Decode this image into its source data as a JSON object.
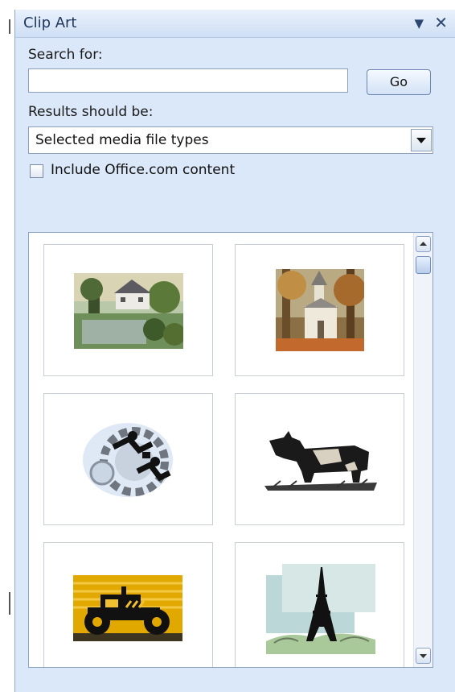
{
  "pane": {
    "title": "Clip Art",
    "dropdown_icon": "triangle-down",
    "close_icon": "x"
  },
  "search": {
    "label": "Search for:",
    "value": "",
    "go_label": "Go"
  },
  "results_filter": {
    "label": "Results should be:",
    "selected": "Selected media file types"
  },
  "include_office": {
    "label": "Include Office.com content",
    "checked": false
  },
  "results": {
    "items": [
      {
        "icon": "cottage-lake-clipart"
      },
      {
        "icon": "church-autumn-clipart"
      },
      {
        "icon": "business-gear-clipart"
      },
      {
        "icon": "cow-clipart"
      },
      {
        "icon": "tractor-clipart"
      },
      {
        "icon": "eiffel-tower-clipart"
      }
    ]
  },
  "colors": {
    "pane_bg": "#dbe8f9",
    "title_text": "#1f3559"
  }
}
